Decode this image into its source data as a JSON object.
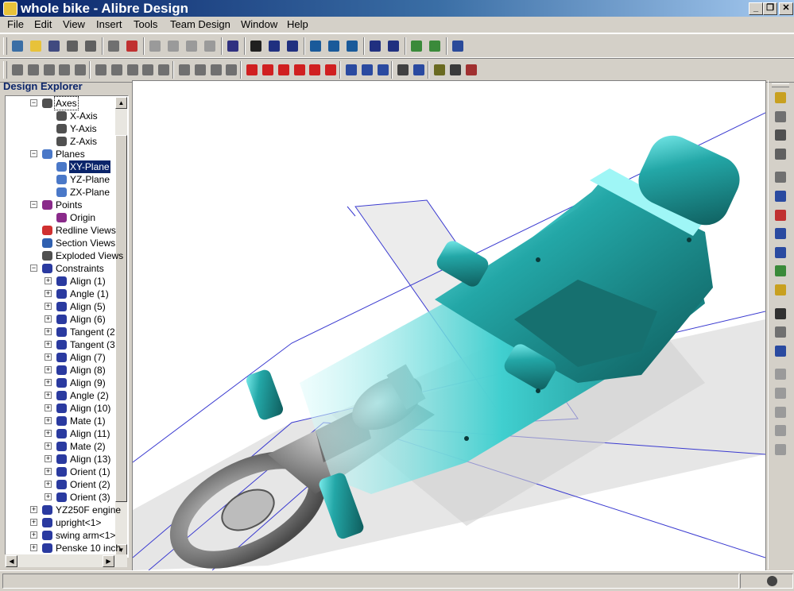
{
  "window": {
    "title": "whole bike - Alibre Design",
    "controls": [
      "_",
      "❐",
      "✕"
    ]
  },
  "menu": [
    {
      "label": "File",
      "key": "F"
    },
    {
      "label": "Edit",
      "key": "E"
    },
    {
      "label": "View",
      "key": "V"
    },
    {
      "label": "Insert",
      "key": "I"
    },
    {
      "label": "Tools",
      "key": "T"
    },
    {
      "label": "Team Design",
      "key": "D"
    },
    {
      "label": "Window",
      "key": "W"
    },
    {
      "label": "Help",
      "key": "H"
    }
  ],
  "toolbar1": [
    {
      "name": "new-icon",
      "color": "#3a6ea5"
    },
    {
      "name": "open-icon",
      "color": "#e8c23a"
    },
    {
      "name": "save-icon",
      "color": "#404a80"
    },
    {
      "name": "check-in-icon",
      "color": "#606060"
    },
    {
      "name": "check-out-icon",
      "color": "#606060"
    },
    {
      "name": "print-icon",
      "color": "#707070"
    },
    {
      "name": "export-pdf-icon",
      "color": "#c03030"
    },
    {
      "name": "cut-icon",
      "color": "#9a9a9a"
    },
    {
      "name": "copy-icon",
      "color": "#9a9a9a"
    },
    {
      "name": "paste-icon",
      "color": "#9a9a9a"
    },
    {
      "name": "delete-icon",
      "color": "#9a9a9a"
    },
    {
      "name": "undo-icon",
      "color": "#303080"
    },
    {
      "name": "select-icon",
      "color": "#202020"
    },
    {
      "name": "pan-icon",
      "color": "#203080"
    },
    {
      "name": "rotate-icon",
      "color": "#203080"
    },
    {
      "name": "zoom-in-icon",
      "color": "#1a5a9a"
    },
    {
      "name": "zoom-window-icon",
      "color": "#1a5a9a"
    },
    {
      "name": "zoom-fit-icon",
      "color": "#1a5a9a"
    },
    {
      "name": "previous-view-icon",
      "color": "#203080"
    },
    {
      "name": "next-view-icon",
      "color": "#203080"
    },
    {
      "name": "shaded-view-icon",
      "color": "#3a8a3a"
    },
    {
      "name": "display-mode-icon",
      "color": "#3a8a3a"
    },
    {
      "name": "render-icon",
      "color": "#2a4a9a"
    }
  ],
  "toolbar2": [
    {
      "name": "anchor-part-icon",
      "color": "#707070"
    },
    {
      "name": "insert-part-icon",
      "color": "#707070"
    },
    {
      "name": "replace-part-icon",
      "color": "#707070"
    },
    {
      "name": "hide-part-icon",
      "color": "#707070"
    },
    {
      "name": "constraint-tool-icon",
      "color": "#707070"
    },
    {
      "name": "pattern-icon",
      "color": "#707070"
    },
    {
      "name": "mirror-icon",
      "color": "#707070"
    },
    {
      "name": "interference-icon",
      "color": "#707070"
    },
    {
      "name": "explode-icon",
      "color": "#707070"
    },
    {
      "name": "drag-part-icon",
      "color": "#707070"
    },
    {
      "name": "move-down-icon",
      "color": "#707070"
    },
    {
      "name": "move-part-icon",
      "color": "#707070"
    },
    {
      "name": "free-move-icon",
      "color": "#707070"
    },
    {
      "name": "send-icon",
      "color": "#707070"
    },
    {
      "name": "redline-pen-icon",
      "color": "#d02020"
    },
    {
      "name": "redline-ellipse-icon",
      "color": "#d02020"
    },
    {
      "name": "redline-rectangle-icon",
      "color": "#d02020"
    },
    {
      "name": "redline-text-icon",
      "color": "#d02020"
    },
    {
      "name": "redline-fill-icon",
      "color": "#d02020"
    },
    {
      "name": "redline-line-style-icon",
      "color": "#d02020"
    },
    {
      "name": "reference-plane-icon",
      "color": "#2a4aa0"
    },
    {
      "name": "reference-axis-icon",
      "color": "#2a4aa0"
    },
    {
      "name": "reference-point-icon",
      "color": "#2a4aa0"
    },
    {
      "name": "bill-of-materials-icon",
      "color": "#404040"
    },
    {
      "name": "properties-icon",
      "color": "#2a4aa0"
    },
    {
      "name": "check-icon",
      "color": "#6a6a20"
    },
    {
      "name": "measure-icon",
      "color": "#3a3a3a"
    },
    {
      "name": "mass-properties-icon",
      "color": "#a03030"
    }
  ],
  "explorer": {
    "title": "Design Explorer",
    "rows": [
      {
        "label": "Axes",
        "level": 1,
        "expander": "−",
        "icon": "axes-icon",
        "color": "#505050",
        "selected": false,
        "dotted": true
      },
      {
        "label": "X-Axis",
        "level": 2,
        "expander": "",
        "icon": "axis-icon",
        "color": "#505050",
        "selected": false
      },
      {
        "label": "Y-Axis",
        "level": 2,
        "expander": "",
        "icon": "axis-icon",
        "color": "#505050",
        "selected": false
      },
      {
        "label": "Z-Axis",
        "level": 2,
        "expander": "",
        "icon": "axis-icon",
        "color": "#505050",
        "selected": false
      },
      {
        "label": "Planes",
        "level": 1,
        "expander": "−",
        "icon": "planes-icon",
        "color": "#4a78c8",
        "selected": false
      },
      {
        "label": "XY-Plane",
        "level": 2,
        "expander": "",
        "icon": "plane-icon",
        "color": "#4a78c8",
        "selected": true
      },
      {
        "label": "YZ-Plane",
        "level": 2,
        "expander": "",
        "icon": "plane-icon",
        "color": "#4a78c8",
        "selected": false
      },
      {
        "label": "ZX-Plane",
        "level": 2,
        "expander": "",
        "icon": "plane-icon",
        "color": "#4a78c8",
        "selected": false
      },
      {
        "label": "Points",
        "level": 1,
        "expander": "−",
        "icon": "points-icon",
        "color": "#8a2a8a",
        "selected": false
      },
      {
        "label": "Origin",
        "level": 2,
        "expander": "",
        "icon": "point-icon",
        "color": "#8a2a8a",
        "selected": false
      },
      {
        "label": "Redline Views",
        "level": 1,
        "expander": "",
        "icon": "redline-views-icon",
        "color": "#d03030",
        "selected": false
      },
      {
        "label": "Section Views",
        "level": 1,
        "expander": "",
        "icon": "section-views-icon",
        "color": "#3060b0",
        "selected": false
      },
      {
        "label": "Exploded Views",
        "level": 1,
        "expander": "",
        "icon": "exploded-views-icon",
        "color": "#505050",
        "selected": false
      },
      {
        "label": "Constraints",
        "level": 1,
        "expander": "−",
        "icon": "constraints-icon",
        "color": "#2a3aa0",
        "selected": false
      },
      {
        "label": "Align (1)",
        "level": 2,
        "expander": "+",
        "icon": "constraint-icon",
        "color": "#2a3aa0",
        "selected": false
      },
      {
        "label": "Angle (1)",
        "level": 2,
        "expander": "+",
        "icon": "constraint-icon",
        "color": "#2a3aa0",
        "selected": false
      },
      {
        "label": "Align (5)",
        "level": 2,
        "expander": "+",
        "icon": "constraint-icon",
        "color": "#2a3aa0",
        "selected": false
      },
      {
        "label": "Align (6)",
        "level": 2,
        "expander": "+",
        "icon": "constraint-icon",
        "color": "#2a3aa0",
        "selected": false
      },
      {
        "label": "Tangent (2",
        "level": 2,
        "expander": "+",
        "icon": "constraint-icon",
        "color": "#2a3aa0",
        "selected": false
      },
      {
        "label": "Tangent (3",
        "level": 2,
        "expander": "+",
        "icon": "constraint-icon",
        "color": "#2a3aa0",
        "selected": false
      },
      {
        "label": "Align (7)",
        "level": 2,
        "expander": "+",
        "icon": "constraint-icon",
        "color": "#2a3aa0",
        "selected": false
      },
      {
        "label": "Align (8)",
        "level": 2,
        "expander": "+",
        "icon": "constraint-icon",
        "color": "#2a3aa0",
        "selected": false
      },
      {
        "label": "Align (9)",
        "level": 2,
        "expander": "+",
        "icon": "constraint-icon",
        "color": "#2a3aa0",
        "selected": false
      },
      {
        "label": "Angle (2)",
        "level": 2,
        "expander": "+",
        "icon": "constraint-icon",
        "color": "#2a3aa0",
        "selected": false
      },
      {
        "label": "Align (10)",
        "level": 2,
        "expander": "+",
        "icon": "constraint-icon",
        "color": "#2a3aa0",
        "selected": false
      },
      {
        "label": "Mate (1)",
        "level": 2,
        "expander": "+",
        "icon": "constraint-icon",
        "color": "#2a3aa0",
        "selected": false
      },
      {
        "label": "Align (11)",
        "level": 2,
        "expander": "+",
        "icon": "constraint-icon",
        "color": "#2a3aa0",
        "selected": false
      },
      {
        "label": "Mate (2)",
        "level": 2,
        "expander": "+",
        "icon": "constraint-icon",
        "color": "#2a3aa0",
        "selected": false
      },
      {
        "label": "Align (13)",
        "level": 2,
        "expander": "+",
        "icon": "constraint-icon",
        "color": "#2a3aa0",
        "selected": false
      },
      {
        "label": "Orient (1)",
        "level": 2,
        "expander": "+",
        "icon": "constraint-icon",
        "color": "#2a3aa0",
        "selected": false
      },
      {
        "label": "Orient (2)",
        "level": 2,
        "expander": "+",
        "icon": "constraint-icon",
        "color": "#2a3aa0",
        "selected": false
      },
      {
        "label": "Orient (3)",
        "level": 2,
        "expander": "+",
        "icon": "constraint-icon",
        "color": "#2a3aa0",
        "selected": false
      },
      {
        "label": "YZ250F engine",
        "level": 1,
        "expander": "+",
        "icon": "part-icon",
        "color": "#2a3aa0",
        "selected": false
      },
      {
        "label": "upright<1>",
        "level": 1,
        "expander": "+",
        "icon": "part-icon",
        "color": "#2a3aa0",
        "selected": false
      },
      {
        "label": "swing arm<1>",
        "level": 1,
        "expander": "+",
        "icon": "part-icon",
        "color": "#2a3aa0",
        "selected": false
      },
      {
        "label": "Penske 10 inch",
        "level": 1,
        "expander": "+",
        "icon": "part-icon",
        "color": "#2a3aa0",
        "selected": false
      }
    ]
  },
  "righttoolbar": [
    {
      "name": "view-cube-icon",
      "color": "#c8a020"
    },
    {
      "name": "grid-icon",
      "color": "#707070"
    },
    {
      "name": "point-tool-icon",
      "color": "#505050"
    },
    {
      "name": "hexagon-icon",
      "color": "#606060"
    },
    {
      "name": "sphere-icon",
      "color": "#707070"
    },
    {
      "name": "part-constraint-icon",
      "color": "#2a4aa0"
    },
    {
      "name": "color-part-icon",
      "color": "#c03030"
    },
    {
      "name": "solid-icon",
      "color": "#2a4aa0"
    },
    {
      "name": "shell-icon",
      "color": "#2a4aa0"
    },
    {
      "name": "body-icon",
      "color": "#3a8a3a"
    },
    {
      "name": "material-icon",
      "color": "#c8a020"
    },
    {
      "name": "function-icon",
      "color": "#303030"
    },
    {
      "name": "curve-icon",
      "color": "#707070"
    },
    {
      "name": "paint-icon",
      "color": "#2a4aa0"
    },
    {
      "name": "sheet-metal-1-icon",
      "color": "#9a9a9a"
    },
    {
      "name": "sheet-metal-2-icon",
      "color": "#9a9a9a"
    },
    {
      "name": "sheet-metal-3-icon",
      "color": "#9a9a9a"
    },
    {
      "name": "sheet-metal-4-icon",
      "color": "#9a9a9a"
    },
    {
      "name": "sheet-metal-5-icon",
      "color": "#9a9a9a"
    }
  ],
  "colors": {
    "frame": "#1f8a8a",
    "frame_light": "#66e0e0",
    "plane_line": "#3a3ad0",
    "plane_fill": "#e6e6e6"
  }
}
